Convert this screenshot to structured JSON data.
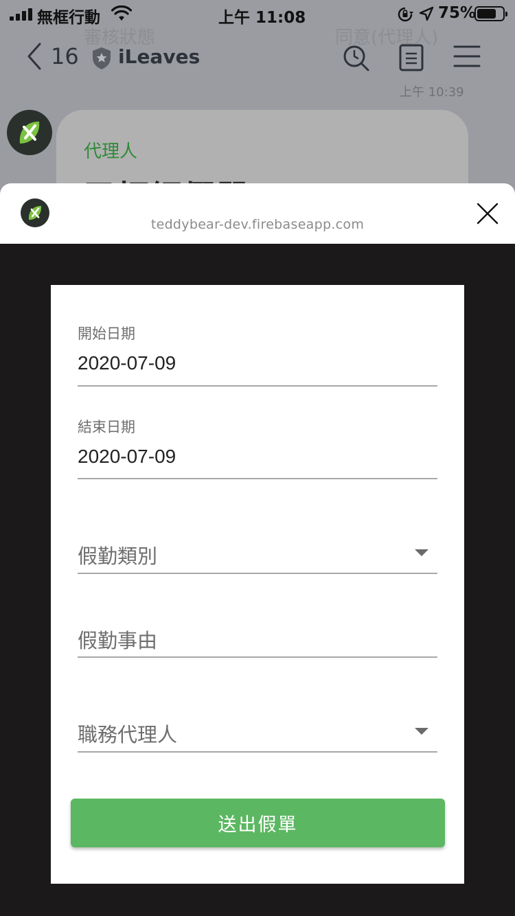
{
  "status_bar": {
    "carrier": "無框行動",
    "time": "上午 11:08",
    "battery_percent": "75%",
    "battery_level": 0.75
  },
  "chat": {
    "ghost_left": "審核狀態",
    "ghost_right": "同意(代理人)",
    "back_count": "16",
    "app_name": "iLeaves",
    "timestamp": "上午 10:39",
    "bubble_sender": "代理人",
    "bubble_title": "已拒絕假單"
  },
  "sheet": {
    "url": "teddybear-dev.firebaseapp.com"
  },
  "form": {
    "start_date_label": "開始日期",
    "start_date_value": "2020-07-09",
    "end_date_label": "結束日期",
    "end_date_value": "2020-07-09",
    "leave_type_placeholder": "假勤類別",
    "leave_reason_placeholder": "假勤事由",
    "deputy_placeholder": "職務代理人",
    "submit_label": "送出假單"
  },
  "colors": {
    "accent_green": "#5cb762",
    "sender_green": "#2e8a37",
    "overlay_dark": "#1b1919"
  },
  "icons": [
    "back-chevron-icon",
    "shield-icon",
    "search-icon",
    "notes-icon",
    "menu-icon",
    "close-icon",
    "dropdown-caret-icon",
    "wifi-icon",
    "location-icon",
    "orientation-lock-icon",
    "battery-icon",
    "leaf-logo-icon"
  ]
}
